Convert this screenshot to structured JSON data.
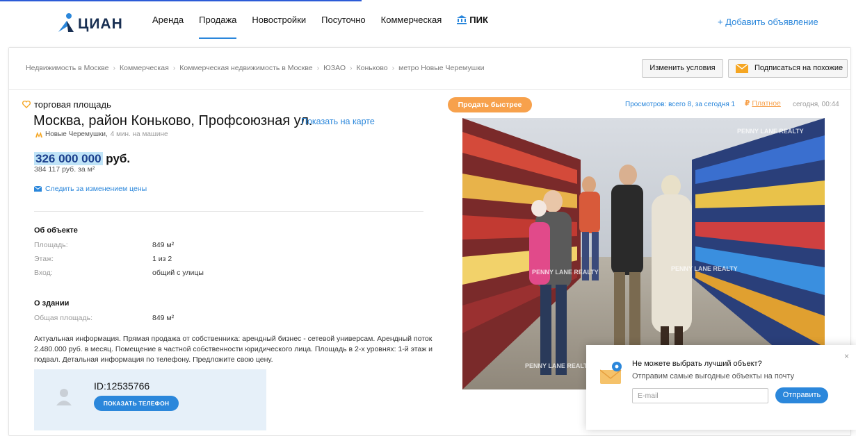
{
  "header": {
    "logo_text": "ЦИАН",
    "nav": [
      {
        "label": "Аренда"
      },
      {
        "label": "Продажа"
      },
      {
        "label": "Новостройки"
      },
      {
        "label": "Посуточно"
      },
      {
        "label": "Коммерческая"
      },
      {
        "label": "ПИК"
      }
    ],
    "add_ad": "+ Добавить объявление"
  },
  "breadcrumbs": [
    "Недвижимость в Москве",
    "Коммерческая",
    "Коммерческая недвижимость в Москве",
    "ЮЗАО",
    "Коньково",
    "метро Новые Черемушки"
  ],
  "toolbar": {
    "change_conditions": "Изменить условия",
    "subscribe": "Подписаться на похожие"
  },
  "listing": {
    "type": "торговая площадь",
    "address": "Москва, район Коньково, Профсоюзная ул.",
    "show_map": "Показать на карте",
    "metro_name": "Новые Черемушки,",
    "metro_time": "4 мин. на машине",
    "price": "326 000 000",
    "price_currency": "руб.",
    "price_per_m2": "384 117 руб. за м²",
    "follow_price": "Следить за изменением цены",
    "object_title": "Об объекте",
    "object_rows": [
      {
        "k": "Площадь:",
        "v": "849 м²"
      },
      {
        "k": "Этаж:",
        "v": "1 из 2"
      },
      {
        "k": "Вход:",
        "v": "общий с улицы"
      }
    ],
    "building_title": "О здании",
    "building_rows": [
      {
        "k": "Общая площадь:",
        "v": "849 м²"
      }
    ],
    "description": "Актуальная информация. Прямая продажа от собственника: арендный бизнес - сетевой универсам. Арендный поток 2.480.000 руб. в месяц. Помещение в частной собственности юридического лица. Площадь в 2-х уровнях: 1-й этаж и подвал. Детальная информация по телефону. Предложите свою цену."
  },
  "agent": {
    "id": "ID:12535766",
    "show_phone": "ПОКАЗАТЬ ТЕЛЕФОН"
  },
  "meta": {
    "sell_fast": "Продать быстрее",
    "views": "Просмотров: всего 8, за сегодня 1",
    "paid": "Платное",
    "date": "сегодня, 00:44"
  },
  "popup": {
    "title": "Не можете выбрать лучший объект?",
    "subtitle": "Отправим самые выгодные объекты на почту",
    "email_placeholder": "E-mail",
    "send": "Отправить",
    "close": "×"
  },
  "colors": {
    "accent": "#2b87db",
    "orange": "#f7a14c",
    "logo": "#182f52",
    "highlight": "#bfe3f7"
  },
  "photo_watermark": "PENNY LANE REALTY"
}
